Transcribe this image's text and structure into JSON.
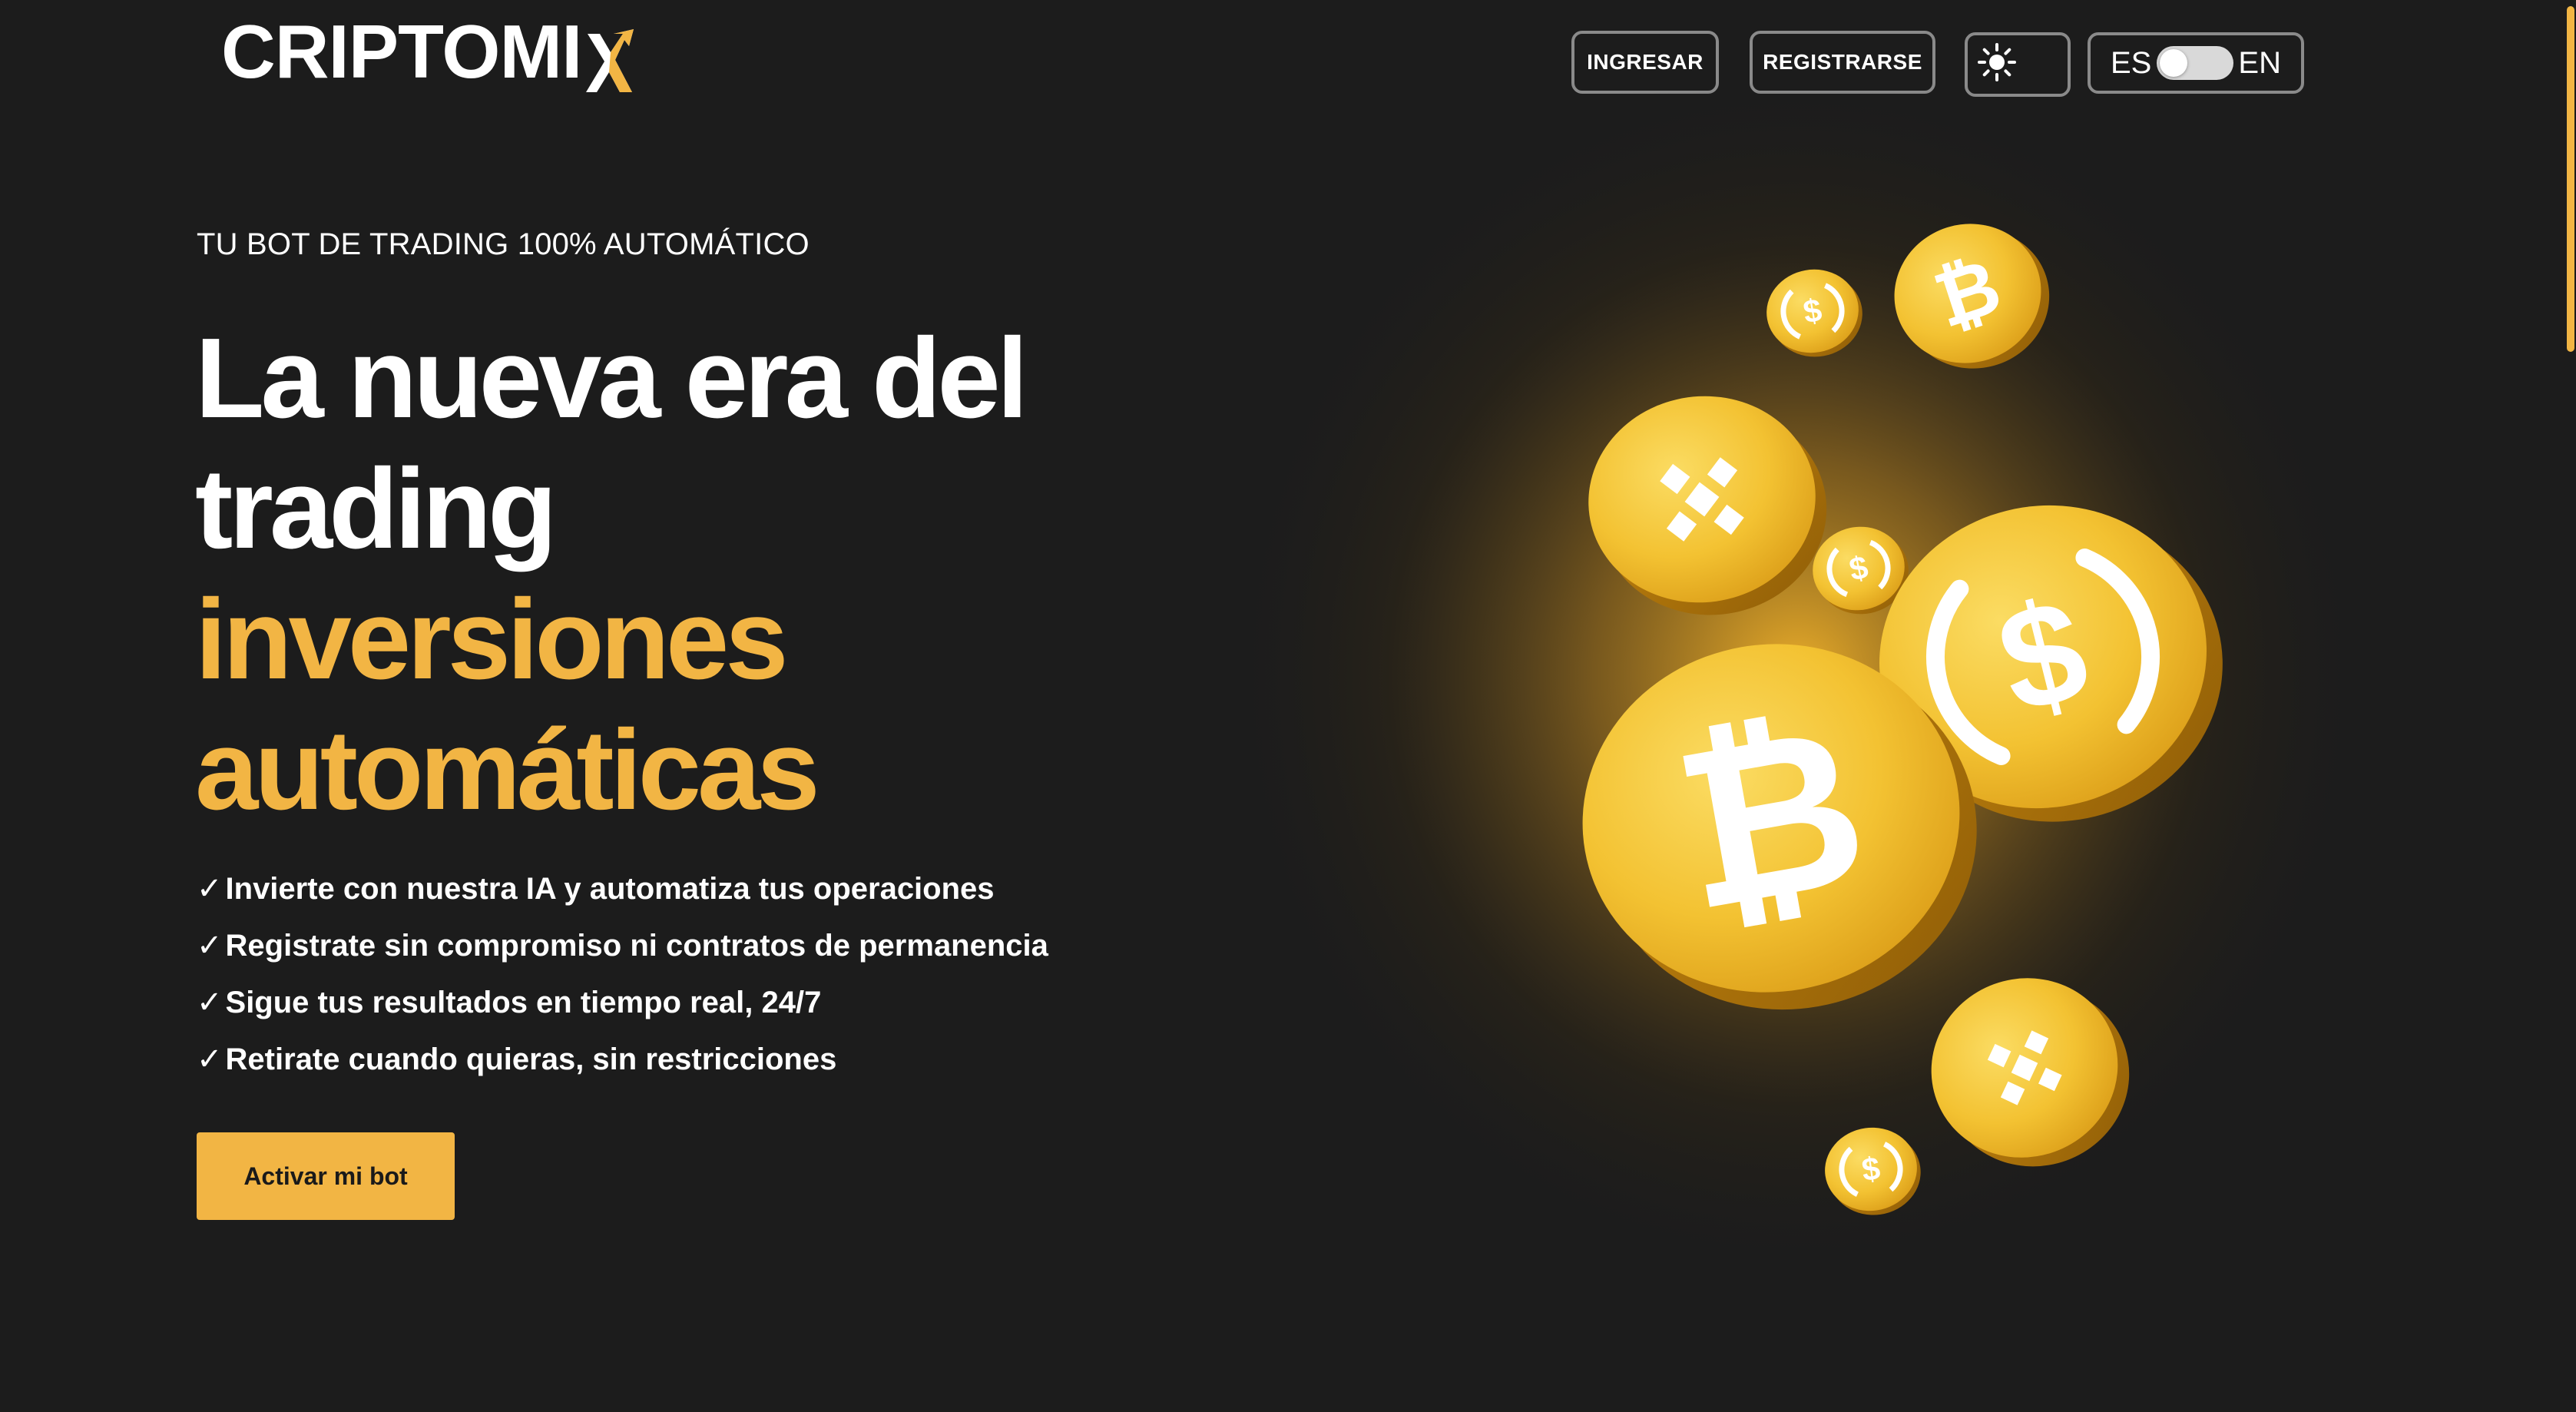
{
  "brand": {
    "logo_text": "CRIPTOMI",
    "logo_accent_letter": "X",
    "accent_color": "#f2b544",
    "background_color": "#1c1c1c"
  },
  "header": {
    "login_label": "INGRESAR",
    "register_label": "REGISTRARSE",
    "theme_icon": "sun-icon",
    "language": {
      "left": "ES",
      "right": "EN",
      "selected": "ES"
    }
  },
  "hero": {
    "eyebrow": "TU BOT DE TRADING 100% AUTOMÁTICO",
    "headline_line1": "La nueva era del",
    "headline_line2": "trading",
    "headline_line3": "inversiones",
    "headline_line4": "automáticas",
    "check_glyph": "✓",
    "features": [
      "Invierte con nuestra IA y automatiza tus operaciones",
      "Registrate sin compromiso ni contratos de permanencia",
      "Sigue tus resultados en tiempo real, 24/7",
      "Retirate cuando quieras, sin restricciones"
    ],
    "cta_label": "Activar mi bot"
  },
  "illustration": {
    "coin_icons": [
      "bitcoin-icon",
      "usd-coin-icon",
      "binance-icon"
    ]
  }
}
